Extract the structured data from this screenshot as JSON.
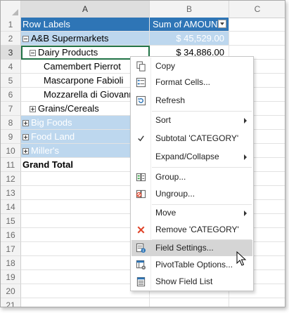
{
  "columns": [
    "A",
    "B",
    "C"
  ],
  "rows": [
    {
      "num": "1",
      "a": "Row Labels",
      "b": "Sum of AMOUNT",
      "style": "header"
    },
    {
      "num": "2",
      "a": "A&B Supermarkets",
      "b": "$ 45,529.00",
      "style": "level1",
      "toggle": "minus"
    },
    {
      "num": "3",
      "a": "Dairy Products",
      "b": "$ 34,886.00",
      "style": "level2",
      "toggle": "minus"
    },
    {
      "num": "4",
      "a": "Camembert Pierrot",
      "b": "",
      "style": "item"
    },
    {
      "num": "5",
      "a": "Mascarpone Fabioli",
      "b": "",
      "style": "item"
    },
    {
      "num": "6",
      "a": "Mozzarella di Giovanni",
      "b": "",
      "style": "item"
    },
    {
      "num": "7",
      "a": "Grains/Cereals",
      "b": "",
      "style": "level2",
      "toggle": "plus"
    },
    {
      "num": "8",
      "a": "Big Foods",
      "b": "",
      "style": "level1w",
      "toggle": "plus"
    },
    {
      "num": "9",
      "a": "Food Land",
      "b": "",
      "style": "level1w",
      "toggle": "plus"
    },
    {
      "num": "10",
      "a": "Miller's",
      "b": "",
      "style": "level1w",
      "toggle": "plus"
    },
    {
      "num": "11",
      "a": "Grand Total",
      "b": "",
      "style": "total"
    },
    {
      "num": "12"
    },
    {
      "num": "13"
    },
    {
      "num": "14"
    },
    {
      "num": "15"
    },
    {
      "num": "16"
    },
    {
      "num": "17"
    },
    {
      "num": "18"
    },
    {
      "num": "19"
    },
    {
      "num": "20"
    },
    {
      "num": "21"
    }
  ],
  "context_menu": {
    "copy": "Copy",
    "format_cells": "Format Cells...",
    "refresh": "Refresh",
    "sort": "Sort",
    "subtotal": "Subtotal 'CATEGORY'",
    "expand_collapse": "Expand/Collapse",
    "group": "Group...",
    "ungroup": "Ungroup...",
    "move": "Move",
    "remove": "Remove 'CATEGORY'",
    "field_settings": "Field Settings...",
    "pivot_options": "PivotTable Options...",
    "show_field_list": "Show Field List"
  },
  "colors": {
    "header_fill": "#2e75b6",
    "level1_fill": "#bdd7ee",
    "menu_hover": "#d5d5d5",
    "remove_icon": "#e0442a"
  }
}
